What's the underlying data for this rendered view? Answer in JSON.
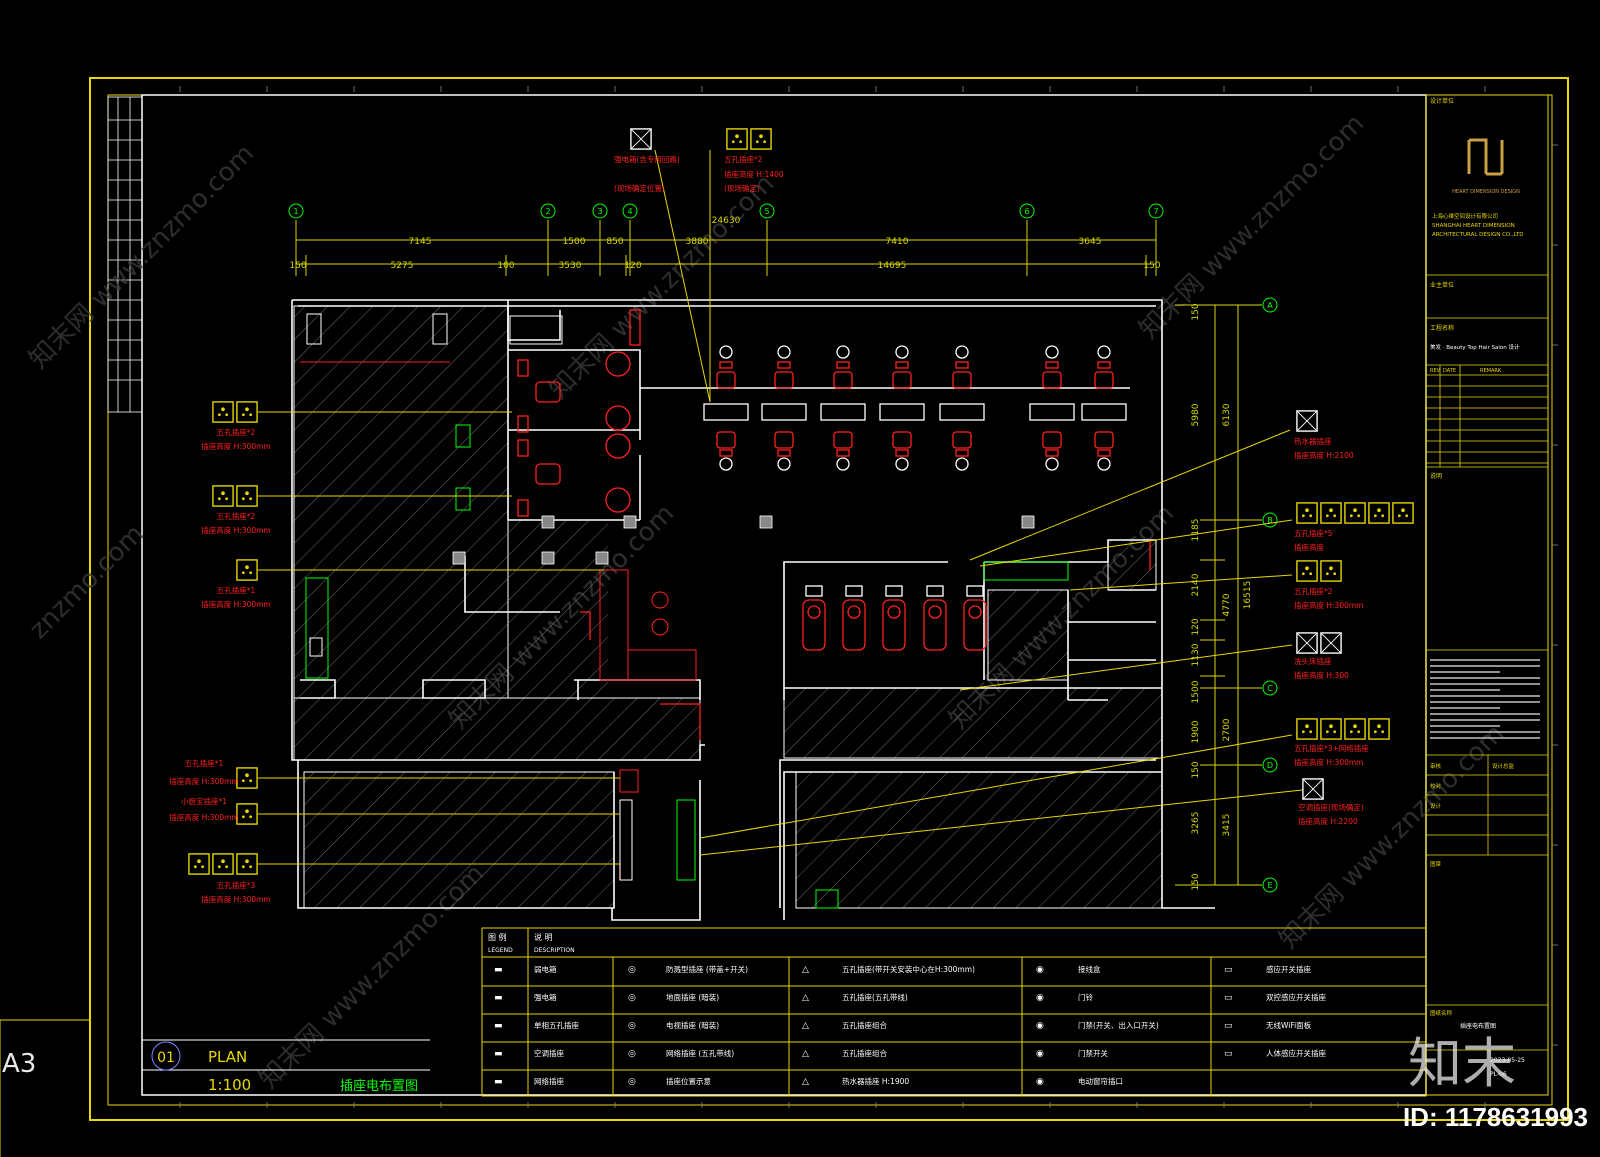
{
  "sheet": {
    "size_label": "A3",
    "plan_number": "01",
    "plan_label": "PLAN",
    "scale": "1:100",
    "plan_title": "插座电布置图"
  },
  "dimensions": {
    "top_row": [
      "7145",
      "1500",
      "850",
      "3880",
      "7410",
      "3645"
    ],
    "bottom_row": [
      "150",
      "5275",
      "100",
      "3530",
      "120",
      "14695",
      "150"
    ],
    "overall": "24630",
    "right_inner": [
      "5980",
      "150",
      "1185",
      "2140",
      "120",
      "1130",
      "1500",
      "1900",
      "150",
      "3265",
      "150"
    ],
    "right_outer": [
      "6130",
      "4770",
      "2700",
      "3415",
      "16515"
    ]
  },
  "grid_bubbles": {
    "top": [
      "1",
      "2",
      "3",
      "4",
      "5",
      "6",
      "7"
    ],
    "right": [
      "A",
      "B",
      "C",
      "D",
      "E"
    ]
  },
  "callouts_left": [
    {
      "line1": "五孔插座*2",
      "line2": "插座高度 H:300mm"
    },
    {
      "line1": "五孔插座*2",
      "line2": "插座高度 H:300mm"
    },
    {
      "line1": "五孔插座*1",
      "line2": "插座高度 H:300mm"
    },
    {
      "line1": "五孔插座*1",
      "line2": "插座高度 H:300mm"
    },
    {
      "line1": "小厨宝插座*1",
      "line2": "插座高度 H:300mm"
    },
    {
      "line1": "五孔插座*3",
      "line2": "插座高度 H:300mm"
    }
  ],
  "callouts_top": [
    {
      "line1": "强电箱(含专用回路)",
      "line2": "(现场确定位置)"
    },
    {
      "line1": "五孔插座*2",
      "line2": "插座高度 H:1400",
      "line3": "(现场确定)"
    }
  ],
  "callouts_right": [
    {
      "line1": "热水器插座",
      "line2": "插座高度 H:2100"
    },
    {
      "line1": "五孔插座*5",
      "line2": "插座高度"
    },
    {
      "line1": "五孔插座*2",
      "line2": "插座高度 H:300mm"
    },
    {
      "line1": "洗头床插座",
      "line2": "插座高度 H:300"
    },
    {
      "line1": "五孔插座*3+网络插座",
      "line2": "插座高度 H:300mm"
    },
    {
      "line1": "空调插座(现场确定)",
      "line2": "插座高度 H:2200"
    }
  ],
  "legend": {
    "header_symbol": "图 例",
    "header_symbol_en": "LEGEND",
    "header_desc": "说 明",
    "header_desc_en": "DESCRIPTION",
    "columns": [
      [
        "弱电箱",
        "强电箱",
        "单相五孔插座",
        "空调插座",
        "网络插座"
      ],
      [
        "防溅型插座 (带盖+开关)",
        "地面插座 (暗装)",
        "电视插座 (暗装)",
        "网络插座 (五孔带线)",
        "插座位置示意"
      ],
      [
        "五孔插座(带开关安装中心在H:300mm)",
        "五孔插座(五孔带线)",
        "五孔插座组合",
        "五孔插座组合",
        "热水器插座 H:1900"
      ],
      [
        "接线盒",
        "门铃",
        "门禁(开关、出入口开关)",
        "门禁开关",
        "电动窗帘插口"
      ],
      [
        "感应开关插座",
        "双控感应开关插座",
        "无线WiFi面板",
        "人体感应开关插座"
      ]
    ]
  },
  "title_block": {
    "firm_label": "设计单位",
    "firm_name_en": "HEART DIMENSION DESIGN",
    "firm_name_cn": "上海心维空间设计有限公司",
    "firm_line2": "SHANGHAI HEART DIMENSION",
    "firm_line3": "ARCHITECTURAL DESIGN CO.,LTD",
    "client_label": "业主单位",
    "project_label": "工程名称",
    "project_name": "美发 · Beauty Top Hair Salon 设计",
    "rev_headers": [
      "REV",
      "DATE",
      "REMARK"
    ],
    "drawing_no_label": "图纸编号",
    "notes_label": "说明",
    "designer_label": "设计总监",
    "approved_label": "审核",
    "checked_label": "校对",
    "drawn_label": "设计",
    "seal_label": "图章",
    "drawing_title_label": "图纸名称",
    "drawing_title": "插座电布置图",
    "date": "2023-05-25",
    "sheet_no": "PL-06"
  },
  "watermarks": [
    "知末网 www.znzmo.com",
    "znzmo.com"
  ],
  "brand": {
    "logo_text": "知末",
    "id_text": "ID: 1178631993"
  },
  "colors": {
    "frame": "#e8d800",
    "wall": "#ffffff",
    "furniture": "#ff2020",
    "dimension": "#d6d600",
    "grid": "#00ff00",
    "hatch": "#888888"
  }
}
